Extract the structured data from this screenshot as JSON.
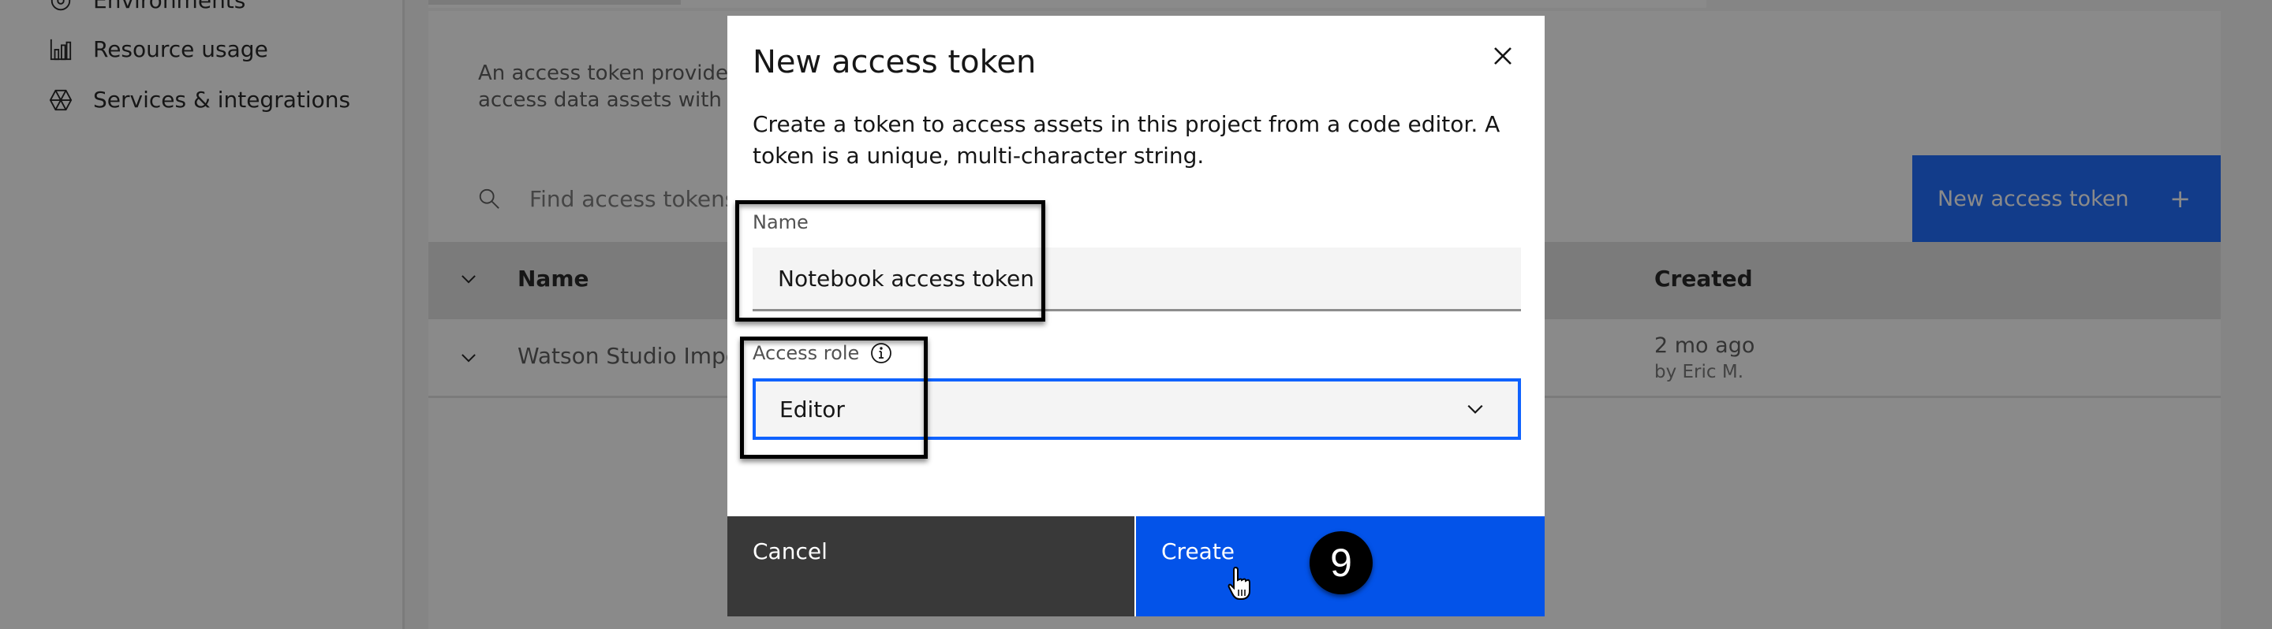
{
  "sidebar": {
    "items": [
      {
        "label": "Environments",
        "icon": "environments-icon"
      },
      {
        "label": "Resource usage",
        "icon": "bar-chart-icon"
      },
      {
        "label": "Services & integrations",
        "icon": "services-icon"
      }
    ]
  },
  "page": {
    "description": "An access token provides p\naccess data assets with AP",
    "search_placeholder": "Find access tokens",
    "new_token_button": "New access token",
    "table": {
      "columns": [
        "Name",
        "Created"
      ],
      "rows": [
        {
          "name": "Watson Studio Impor",
          "created": "2 mo ago",
          "created_by": "by Eric M."
        }
      ]
    }
  },
  "modal": {
    "title": "New access token",
    "body": "Create a token to access assets in this project from a code editor. A token is a unique, multi-character string.",
    "name_label": "Name",
    "name_value": "Notebook access token",
    "role_label": "Access role",
    "role_value": "Editor",
    "cancel_label": "Cancel",
    "create_label": "Create"
  },
  "annotation": {
    "step_number": "9"
  },
  "colors": {
    "primary": "#0f62fe",
    "create_button": "#0353e9",
    "cancel_button": "#393939",
    "overlay": "rgba(22,22,22,0.5)"
  }
}
